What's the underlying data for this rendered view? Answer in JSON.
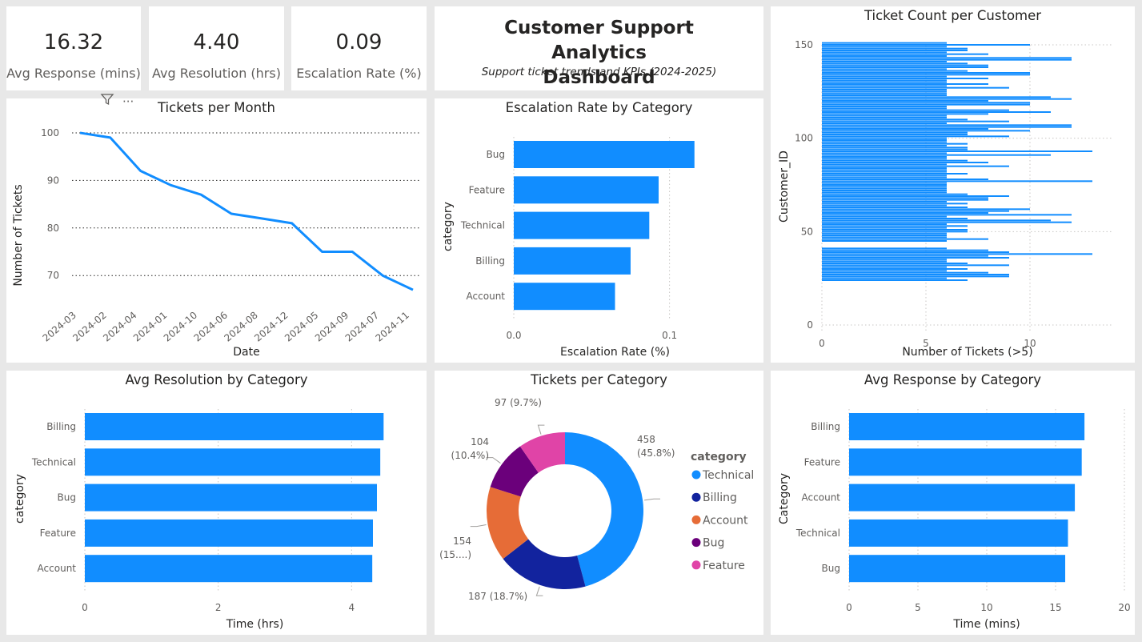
{
  "kpis": [
    {
      "value": "16.32",
      "label": "Avg Response (mins)"
    },
    {
      "value": "4.40",
      "label": "Avg Resolution (hrs)"
    },
    {
      "value": "0.09",
      "label": "Escalation Rate (%)"
    }
  ],
  "header": {
    "title": "Customer Support Analytics Dashboard",
    "subtitle": "Support ticket trends and KPIs (2024-2025)"
  },
  "visual_header": {
    "filter_icon": "filter-icon",
    "more_icon": "more-options-icon",
    "more_glyph": "···"
  },
  "colors": {
    "bar": "#118dff",
    "technical": "#118dff",
    "billing": "#12239e",
    "account": "#e66c37",
    "bug": "#6b007b",
    "feature": "#e044a7"
  },
  "chart_data": [
    {
      "id": "tickets_per_month",
      "type": "line",
      "title": "Tickets per Month",
      "xlabel": "Date",
      "ylabel": "Number of Tickets",
      "categories": [
        "2024-03",
        "2024-02",
        "2024-04",
        "2024-01",
        "2024-10",
        "2024-06",
        "2024-08",
        "2024-12",
        "2024-05",
        "2024-09",
        "2024-07",
        "2024-11"
      ],
      "values": [
        100,
        99,
        92,
        89,
        87,
        83,
        82,
        81,
        75,
        75,
        70,
        67
      ],
      "yticks": [
        70,
        80,
        90,
        100
      ],
      "ylim": [
        66,
        101
      ],
      "grid": true
    },
    {
      "id": "escalation_by_category",
      "type": "bar",
      "orientation": "horizontal",
      "title": "Escalation Rate by Category",
      "xlabel": "Escalation Rate (%)",
      "ylabel": "category",
      "categories": [
        "Bug",
        "Feature",
        "Technical",
        "Billing",
        "Account"
      ],
      "values": [
        0.116,
        0.093,
        0.087,
        0.075,
        0.065
      ],
      "xticks": [
        0.0,
        0.1
      ],
      "xtick_labels": [
        "0.0",
        "0.1"
      ],
      "xlim": [
        0,
        0.13
      ],
      "grid": true
    },
    {
      "id": "ticket_count_per_customer",
      "type": "bar",
      "orientation": "horizontal",
      "title": "Ticket Count per Customer",
      "xlabel": "Number of Tickets (>5)",
      "ylabel": "Customer_ID",
      "ylim": [
        0,
        150
      ],
      "xlim": [
        0,
        14
      ],
      "xticks": [
        0,
        5,
        10
      ],
      "yticks": [
        0,
        50,
        100,
        150
      ],
      "grid": true,
      "customer_ids": [
        151,
        150,
        149,
        148,
        147,
        146,
        145,
        144,
        143,
        142,
        141,
        140,
        139,
        138,
        137,
        136,
        135,
        134,
        133,
        132,
        131,
        130,
        129,
        128,
        127,
        126,
        125,
        124,
        123,
        122,
        121,
        120,
        119,
        118,
        117,
        116,
        115,
        114,
        113,
        112,
        111,
        110,
        109,
        108,
        107,
        106,
        105,
        104,
        103,
        102,
        101,
        100,
        99,
        98,
        97,
        96,
        95,
        94,
        93,
        92,
        91,
        90,
        89,
        88,
        87,
        86,
        85,
        84,
        83,
        82,
        81,
        80,
        79,
        78,
        77,
        76,
        75,
        74,
        73,
        72,
        71,
        70,
        69,
        68,
        67,
        66,
        65,
        64,
        63,
        62,
        61,
        60,
        59,
        58,
        57,
        56,
        55,
        54,
        53,
        52,
        51,
        50,
        49,
        48,
        47,
        46,
        45,
        44,
        43,
        42,
        41,
        40,
        39,
        38,
        37,
        36,
        35,
        34,
        33,
        32,
        31,
        30,
        29,
        28,
        27,
        26,
        25,
        24,
        23,
        22,
        21,
        20,
        19,
        18,
        17,
        16,
        15,
        14,
        13,
        12,
        11,
        10,
        9,
        8,
        7,
        6,
        5,
        4,
        3,
        2,
        1
      ],
      "values": [
        6,
        10,
        6,
        7,
        7,
        6,
        8,
        6,
        12,
        12,
        6,
        7,
        8,
        8,
        6,
        7,
        10,
        10,
        6,
        8,
        6,
        6,
        8,
        6,
        9,
        6,
        6,
        6,
        6,
        11,
        12,
        8,
        10,
        10,
        6,
        6,
        9,
        11,
        8,
        6,
        6,
        7,
        9,
        6,
        12,
        12,
        8,
        10,
        7,
        7,
        9,
        6,
        6,
        6,
        7,
        6,
        7,
        7,
        13,
        6,
        11,
        6,
        6,
        7,
        8,
        6,
        9,
        6,
        6,
        6,
        7,
        6,
        6,
        8,
        13,
        6,
        6,
        6,
        6,
        6,
        6,
        7,
        9,
        8,
        8,
        6,
        7,
        6,
        7,
        10,
        9,
        8,
        12,
        6,
        7,
        11,
        12,
        6,
        7,
        6,
        7,
        7,
        6,
        6,
        6,
        8,
        6,
        0,
        0,
        0,
        6,
        8,
        9,
        13,
        8,
        9,
        6,
        6,
        7,
        9,
        6,
        7,
        6,
        8,
        9,
        9,
        6,
        7
      ],
      "values_note": ""
    },
    {
      "id": "avg_resolution_by_category",
      "type": "bar",
      "orientation": "horizontal",
      "title": "Avg Resolution by Category",
      "xlabel": "Time (hrs)",
      "ylabel": "category",
      "categories": [
        "Billing",
        "Technical",
        "Bug",
        "Feature",
        "Account"
      ],
      "values": [
        4.48,
        4.43,
        4.38,
        4.32,
        4.31
      ],
      "xticks": [
        0,
        2,
        4
      ],
      "xlim": [
        0,
        5.1
      ],
      "grid": true
    },
    {
      "id": "tickets_per_category",
      "type": "pie",
      "donut": true,
      "title": "Tickets per Category",
      "legend_title": "category",
      "legend_position": "right",
      "slices": [
        {
          "name": "Technical",
          "value": 458,
          "label1": "458",
          "label2": "(45.8%)",
          "color": "#118dff"
        },
        {
          "name": "Billing",
          "value": 187,
          "label1": "187 (18.7%)",
          "label2": "",
          "color": "#12239e"
        },
        {
          "name": "Account",
          "value": 154,
          "label1": "154",
          "label2": "(15....)",
          "color": "#e66c37"
        },
        {
          "name": "Bug",
          "value": 104,
          "label1": "104",
          "label2": "(10.4%)",
          "color": "#6b007b"
        },
        {
          "name": "Feature",
          "value": 97,
          "label1": "97 (9.7%)",
          "label2": "",
          "color": "#e044a7"
        }
      ]
    },
    {
      "id": "avg_response_by_category",
      "type": "bar",
      "orientation": "horizontal",
      "title": "Avg Response by Category",
      "xlabel": "Time (mins)",
      "ylabel": "Category",
      "categories": [
        "Billing",
        "Feature",
        "Account",
        "Technical",
        "Bug"
      ],
      "values": [
        17.1,
        16.9,
        16.4,
        15.9,
        15.7
      ],
      "xticks": [
        0,
        5,
        10,
        15,
        20
      ],
      "xlim": [
        0,
        20
      ],
      "grid": true
    }
  ]
}
